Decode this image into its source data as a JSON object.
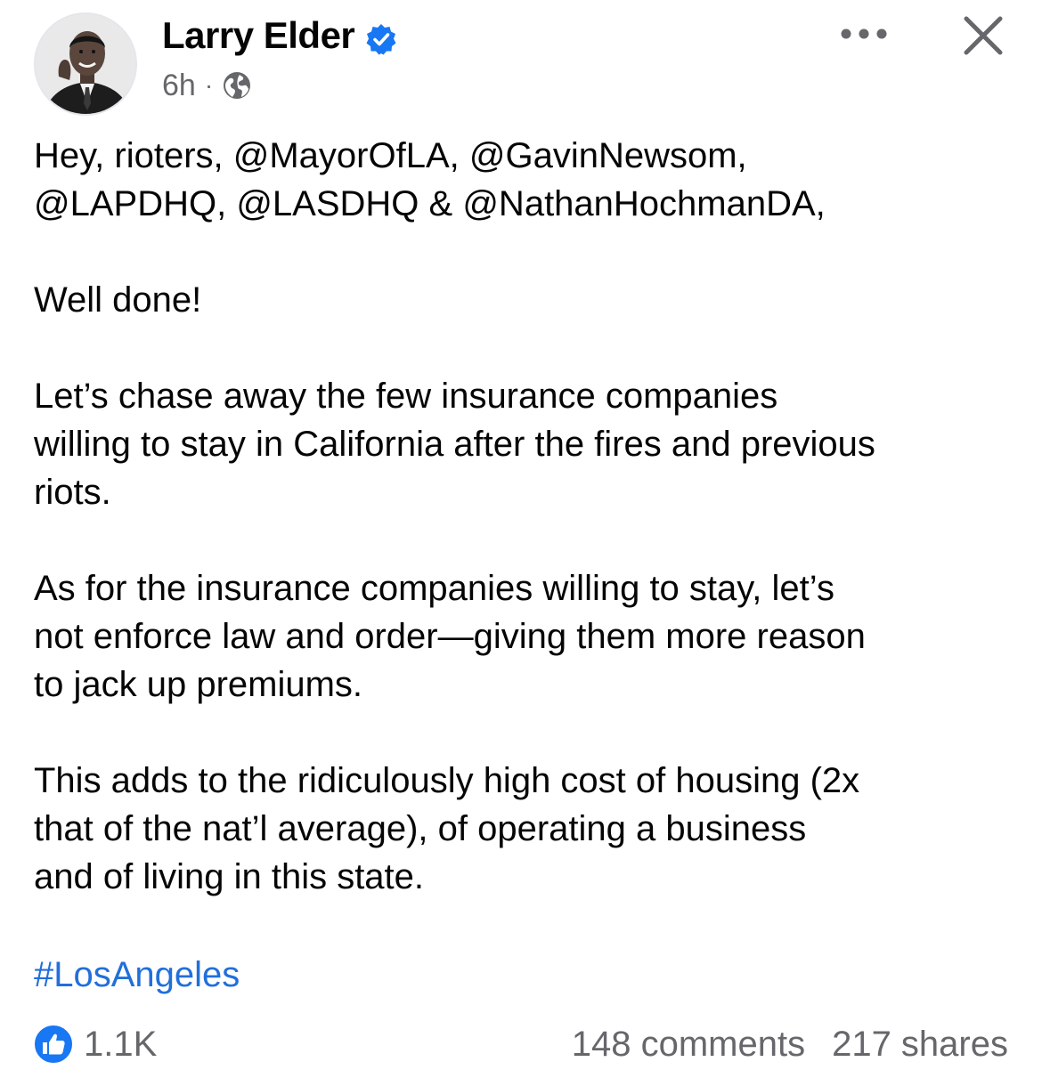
{
  "post": {
    "author": "Larry Elder",
    "time": "6h",
    "separator": "·",
    "privacy_icon": "globe-icon",
    "verified_icon": "verified-badge-icon",
    "more_icon": "more-options-icon",
    "close_icon": "close-icon",
    "paragraphs": [
      "Hey, rioters, @MayorOfLA, @GavinNewsom,\n@LAPDHQ, @LASDHQ & @NathanHochmanDA,",
      "Well done!",
      "Let’s chase away the few insurance companies\nwilling to stay in California after the fires and previous\nriots.",
      "As for the insurance companies willing to stay, let’s\nnot enforce law and order—giving them more reason\nto jack up premiums.",
      "This adds to the ridiculously high cost of housing (2x\nthat of the nat’l average), of operating a business\nand of living in this state."
    ],
    "hashtag": "#LosAngeles"
  },
  "footer": {
    "reaction_icon": "like-icon",
    "reaction_count": "1.1K",
    "comments": "148 comments",
    "shares": "217 shares"
  },
  "colors": {
    "verified_blue": "#1877f2",
    "hashtag_blue": "#216fdb",
    "secondary_text": "#65676b"
  }
}
